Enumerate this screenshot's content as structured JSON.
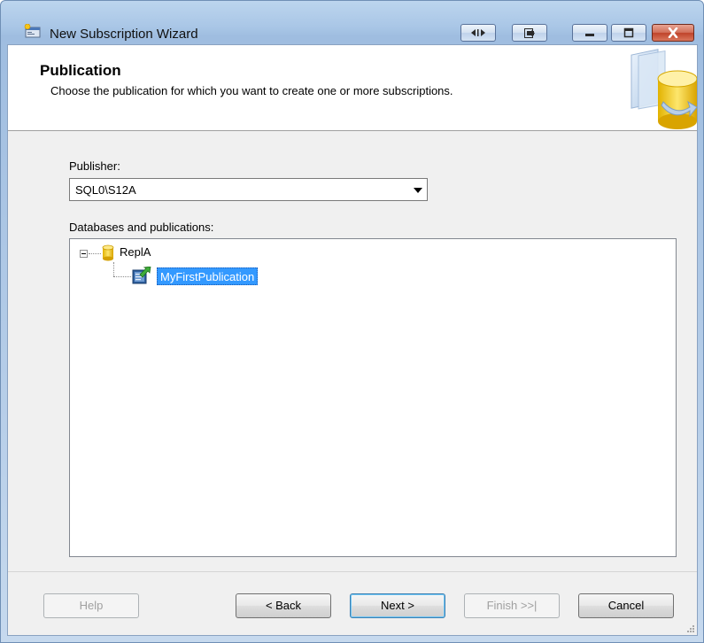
{
  "window": {
    "title": "New Subscription Wizard",
    "app_icon": "wizard-app-icon",
    "controls": [
      "resize-horizontal-icon",
      "restore-down-icon",
      "minimize-icon",
      "maximize-icon",
      "close-icon"
    ]
  },
  "header": {
    "title": "Publication",
    "subtitle": "Choose the publication for which you want to create one or more subscriptions.",
    "graphic": "database-wizard-graphic"
  },
  "publisher": {
    "label": "Publisher:",
    "selected": "SQL0\\S12A"
  },
  "databases": {
    "label": "Databases and publications:",
    "tree": [
      {
        "label": "ReplA",
        "icon": "database-icon",
        "expanded": true,
        "children": [
          {
            "label": "MyFirstPublication",
            "icon": "publication-icon",
            "selected": true
          }
        ]
      }
    ]
  },
  "buttons": {
    "help": "Help",
    "back": "< Back",
    "next": "Next >",
    "finish": "Finish >>|",
    "cancel": "Cancel"
  },
  "colors": {
    "selection": "#3399ff",
    "close_button": "#c0442a",
    "frame": "#a9c6e6"
  }
}
